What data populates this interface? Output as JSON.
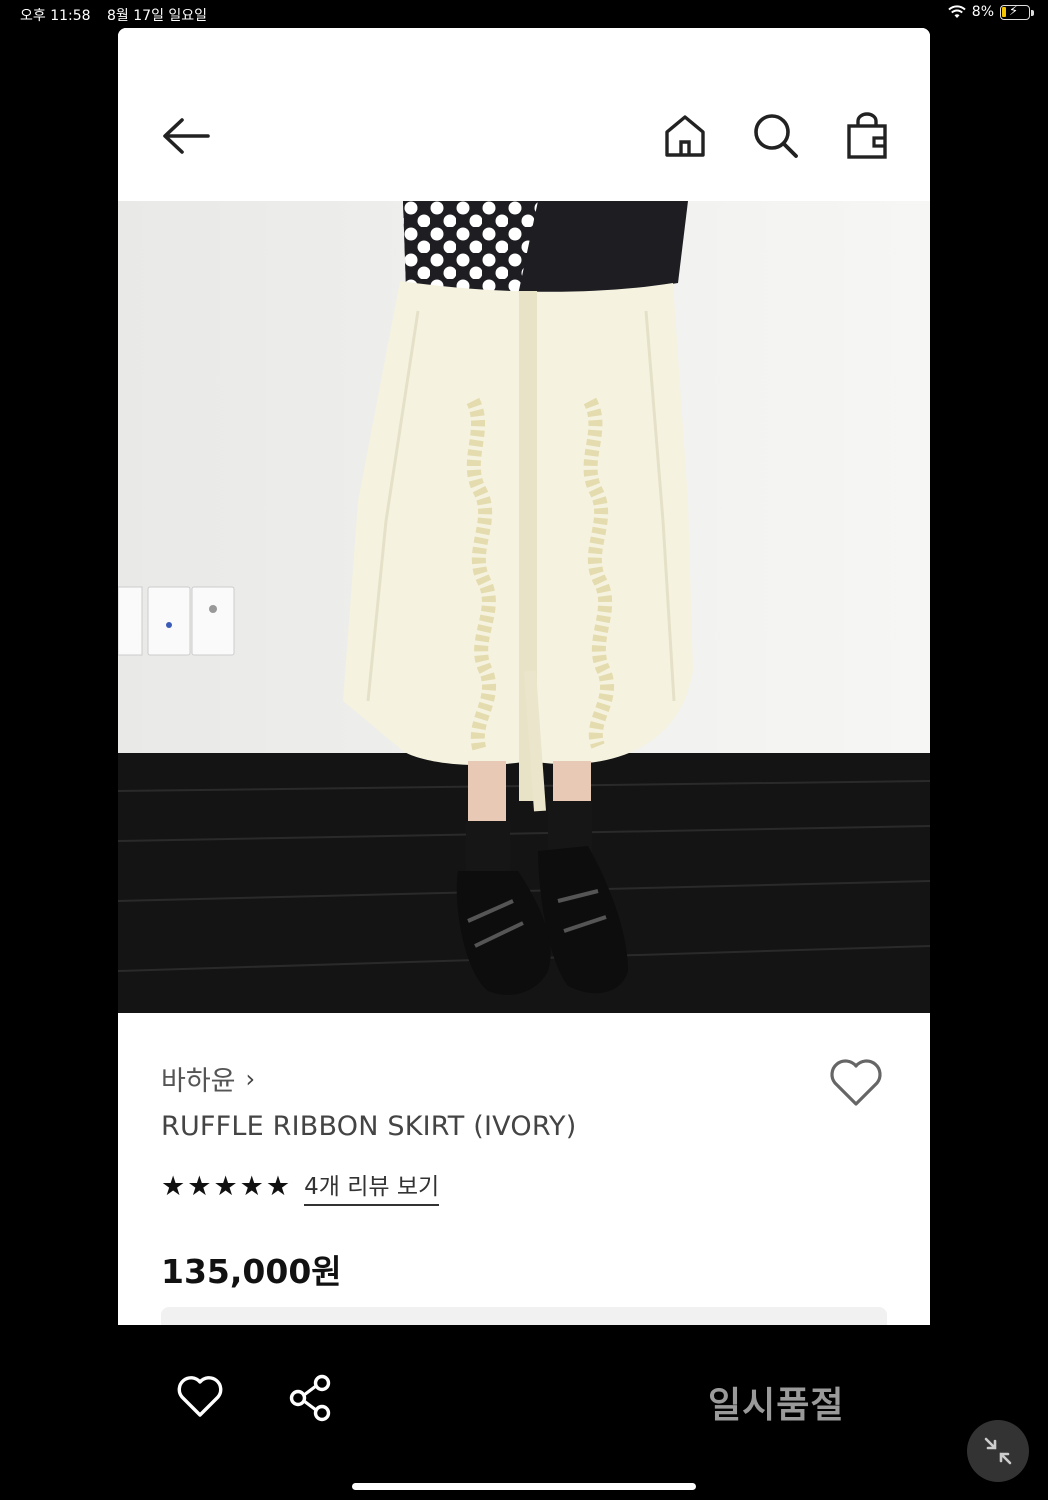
{
  "status_bar": {
    "time": "오후 11:58",
    "date": "8월 17일 일요일",
    "battery": "8%"
  },
  "nav": {
    "back_icon": "arrow-left-icon",
    "home_icon": "home-icon",
    "search_icon": "search-icon",
    "bag_icon": "shopping-bag-icon"
  },
  "product": {
    "brand": "바하윤",
    "brand_chevron": "›",
    "name": "RUFFLE RIBBON SKIRT (IVORY)",
    "stars": 5,
    "review_link": "4개 리뷰 보기",
    "price": "135,000원"
  },
  "bottom_bar": {
    "soldout_label": "일시품절"
  },
  "colors": {
    "background": "#000000",
    "sheet": "#ffffff",
    "soldout_text": "#9a9a9a"
  }
}
